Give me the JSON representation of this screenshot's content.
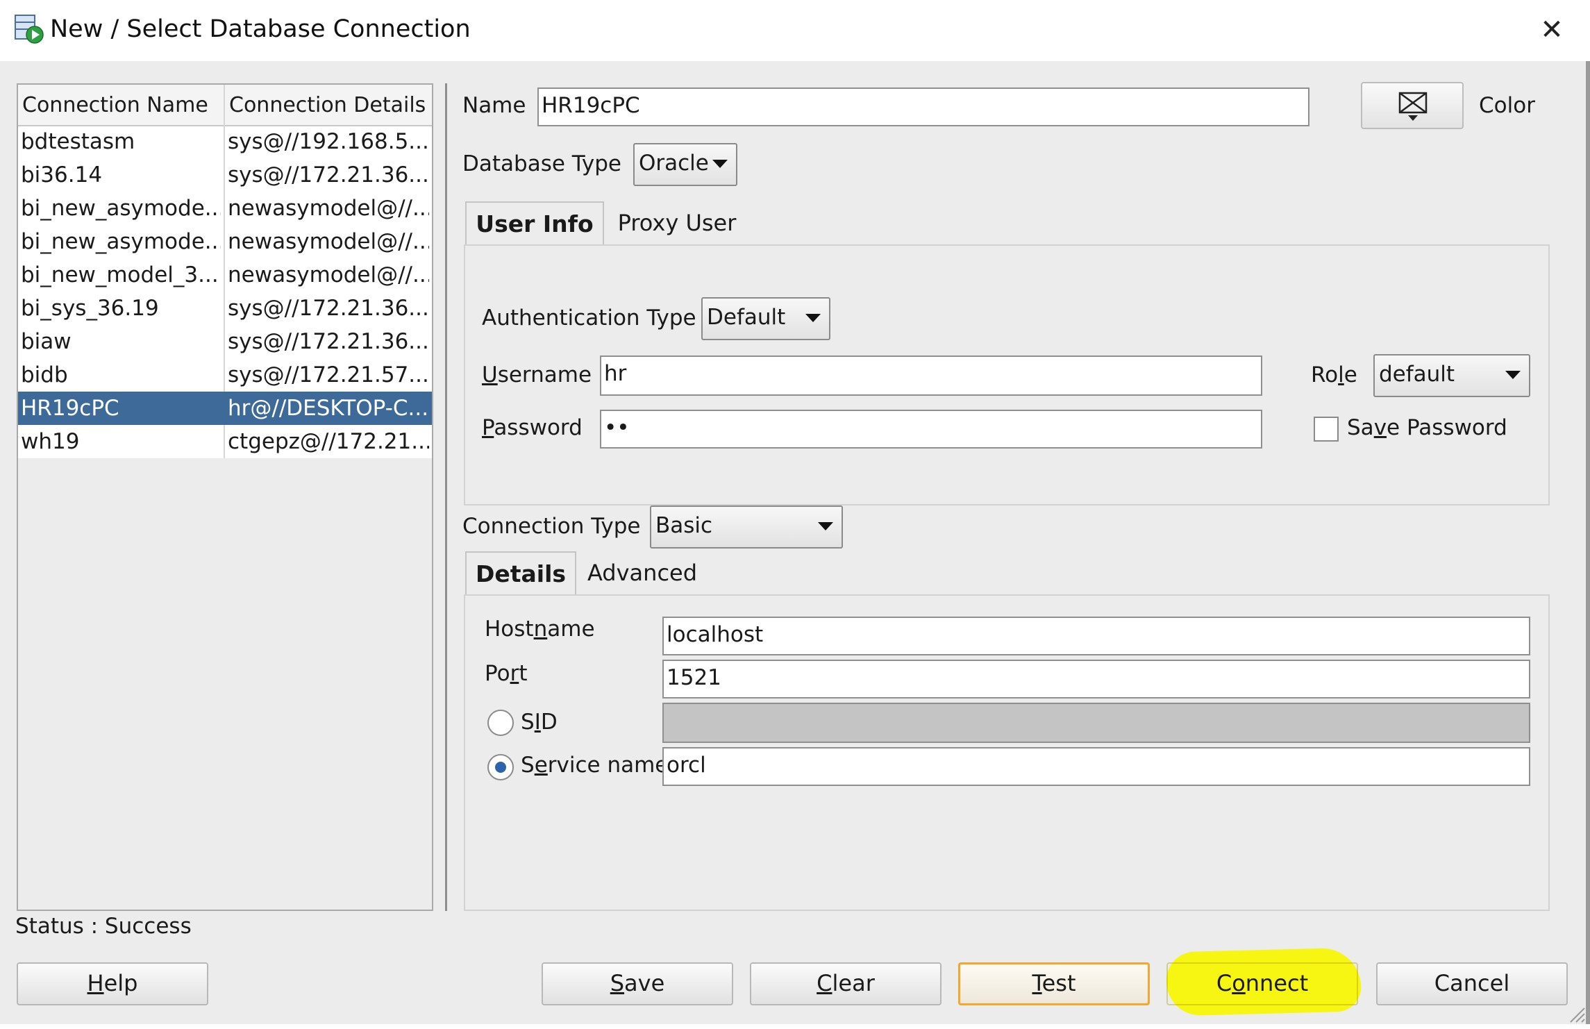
{
  "window": {
    "title": "New / Select Database Connection",
    "close_glyph": "✕"
  },
  "connections": {
    "headers": [
      "Connection Name",
      "Connection Details"
    ],
    "rows": [
      {
        "name": "bdtestasm",
        "details": "sys@//192.168.5..."
      },
      {
        "name": "bi36.14",
        "details": "sys@//172.21.36..."
      },
      {
        "name": "bi_new_asymode...",
        "details": "newasymodel@//..."
      },
      {
        "name": "bi_new_asymode...",
        "details": "newasymodel@//..."
      },
      {
        "name": "bi_new_model_3...",
        "details": "newasymodel@//..."
      },
      {
        "name": "bi_sys_36.19",
        "details": "sys@//172.21.36..."
      },
      {
        "name": "biaw",
        "details": "sys@//172.21.36..."
      },
      {
        "name": "bidb",
        "details": "sys@//172.21.57..."
      },
      {
        "name": "HR19cPC",
        "details": "hr@//DESKTOP-C..."
      },
      {
        "name": "wh19",
        "details": "ctgepz@//172.21..."
      }
    ],
    "selected_index": 8
  },
  "status": "Status : Success",
  "form": {
    "name_label": "Name",
    "name_value": "HR19cPC",
    "color_label": "Color",
    "database_type_label": "Database Type",
    "database_type_value": "Oracle",
    "tabs_top": [
      "User Info",
      "Proxy User"
    ],
    "authentication_type_label": "Authentication Type",
    "authentication_type_value": "Default",
    "username_label_mn": "U",
    "username_label_rest": "sername",
    "username_value": "hr",
    "password_label_mn": "P",
    "password_label_rest": "assword",
    "password_value": "••",
    "role_label_pre": "Ro",
    "role_label_mn": "l",
    "role_label_post": "e",
    "role_value": "default",
    "save_password_pre": "Sa",
    "save_password_mn": "v",
    "save_password_post": "e Password",
    "connection_type_label": "Connection Type",
    "connection_type_value": "Basic",
    "tabs_bottom": [
      "Details",
      "Advanced"
    ],
    "hostname_label_pre": "Host",
    "hostname_label_mn": "n",
    "hostname_label_post": "ame",
    "hostname_value": "localhost",
    "port_label_pre": "Po",
    "port_label_mn": "r",
    "port_label_post": "t",
    "port_value": "1521",
    "sid_label_pre": "S",
    "sid_label_mn": "I",
    "sid_label_post": "D",
    "sid_value": "",
    "service_name_label_pre": "S",
    "service_name_label_mn": "e",
    "service_name_label_post": "rvice name",
    "service_name_value": "orcl"
  },
  "buttons": {
    "help_mn": "H",
    "help_rest": "elp",
    "save_mn": "S",
    "save_rest": "ave",
    "clear_mn": "C",
    "clear_rest": "lear",
    "test_mn": "T",
    "test_rest": "est",
    "connect_pre": "C",
    "connect_mn": "o",
    "connect_post": "nnect",
    "cancel_label": "Cancel"
  },
  "colors": {
    "selection": "#3d6a99",
    "highlight": "#f7f512",
    "focus_border": "#f0a830",
    "radio_dot": "#2f62a8"
  }
}
